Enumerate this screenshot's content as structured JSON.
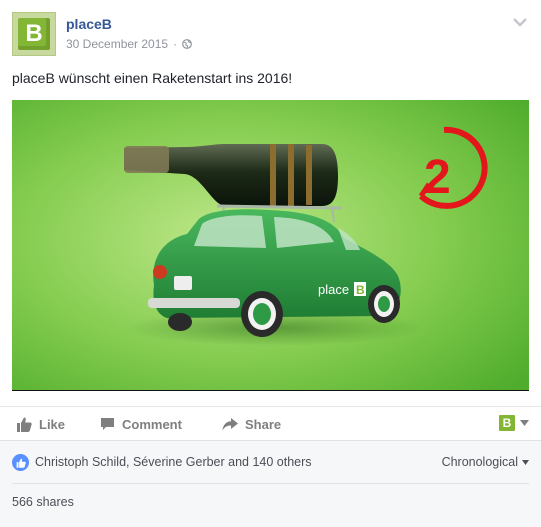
{
  "post": {
    "author": "placeB",
    "avatar_letter": "B",
    "timestamp": "30 December 2015",
    "separator": "·",
    "privacy_icon": "globe-icon",
    "options_icon": "chevron-down-icon",
    "text": "placeB wünscht einen Raketenstart ins 2016!"
  },
  "photo": {
    "description_icon": "green-car-with-champagne-bottle-image",
    "car_brand_text": "place",
    "car_logo_letter": "B",
    "countdown_number": "2",
    "colors": {
      "background": "#7ec94e",
      "car": "#2e9a45",
      "accent_red": "#e2161b"
    }
  },
  "actions": {
    "like_label": "Like",
    "comment_label": "Comment",
    "share_label": "Share",
    "page_selector_letter": "B"
  },
  "footer": {
    "reactors_text": "Christoph Schild, Séverine Gerber and 140 others",
    "sort_label": "Chronological",
    "shares_text": "566 shares"
  },
  "colors": {
    "link": "#365899",
    "brand_green": "#83b634",
    "like_blue": "#5890ff",
    "muted": "#90949c"
  }
}
